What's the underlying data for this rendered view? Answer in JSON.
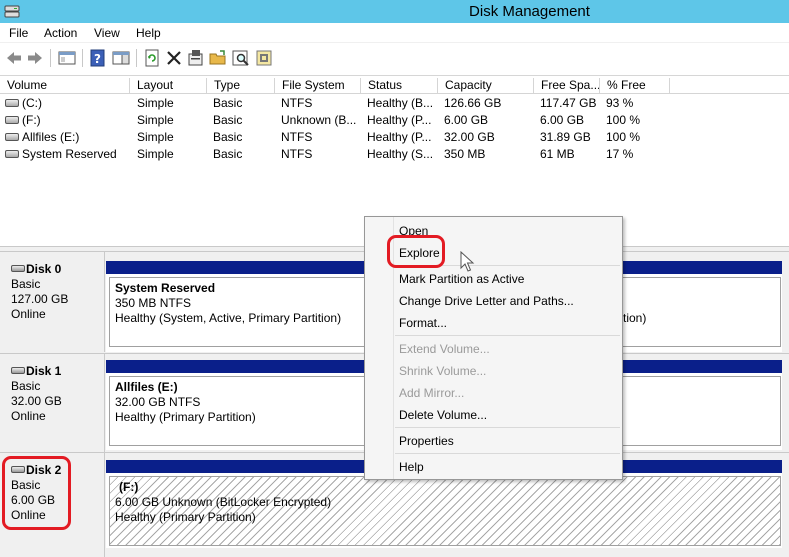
{
  "window": {
    "title": "Disk Management",
    "icon": "disk-management-icon"
  },
  "menu": [
    "File",
    "Action",
    "View",
    "Help"
  ],
  "toolbar": {
    "buttons": [
      "back-icon",
      "forward-icon",
      "console-icon",
      "help-icon",
      "properties-pane-icon",
      "refresh-icon",
      "delete-icon",
      "properties-icon",
      "open-icon",
      "search-icon",
      "settings-icon"
    ]
  },
  "volume_table": {
    "columns": [
      "Volume",
      "Layout",
      "Type",
      "File System",
      "Status",
      "Capacity",
      "Free Spa...",
      "% Free"
    ],
    "rows": [
      [
        "(C:)",
        "Simple",
        "Basic",
        "NTFS",
        "Healthy (B...",
        "126.66 GB",
        "117.47 GB",
        "93 %"
      ],
      [
        "(F:)",
        "Simple",
        "Basic",
        "Unknown (B...",
        "Healthy (P...",
        "6.00 GB",
        "6.00 GB",
        "100 %"
      ],
      [
        "Allfiles (E:)",
        "Simple",
        "Basic",
        "NTFS",
        "Healthy (P...",
        "32.00 GB",
        "31.89 GB",
        "100 %"
      ],
      [
        "System Reserved",
        "Simple",
        "Basic",
        "NTFS",
        "Healthy (S...",
        "350 MB",
        "61 MB",
        "17 %"
      ]
    ]
  },
  "disks": [
    {
      "name": "Disk 0",
      "type": "Basic",
      "size": "127.00 GB",
      "state": "Online",
      "partition": {
        "name": "System Reserved",
        "size_fs": "350 MB NTFS",
        "status": "Healthy (System, Active, Primary Partition)",
        "status_tail": "tion)"
      }
    },
    {
      "name": "Disk 1",
      "type": "Basic",
      "size": "32.00 GB",
      "state": "Online",
      "partition": {
        "name": "Allfiles  (E:)",
        "size_fs": "32.00 GB NTFS",
        "status": "Healthy (Primary Partition)"
      }
    },
    {
      "name": "Disk 2",
      "type": "Basic",
      "size": "6.00 GB",
      "state": "Online",
      "partition": {
        "name": "(F:)",
        "size_fs": "6.00 GB Unknown (BitLocker Encrypted)",
        "status": "Healthy (Primary Partition)"
      }
    }
  ],
  "context_menu": {
    "items": [
      {
        "label": "Open",
        "enabled": true
      },
      {
        "label": "Explore",
        "enabled": true
      },
      {
        "label": "Mark Partition as Active",
        "enabled": true
      },
      {
        "label": "Change Drive Letter and Paths...",
        "enabled": true
      },
      {
        "label": "Format...",
        "enabled": true
      },
      {
        "label": "Extend Volume...",
        "enabled": false
      },
      {
        "label": "Shrink Volume...",
        "enabled": false
      },
      {
        "label": "Add Mirror...",
        "enabled": false
      },
      {
        "label": "Delete Volume...",
        "enabled": true
      },
      {
        "label": "Properties",
        "enabled": true
      },
      {
        "label": "Help",
        "enabled": true
      }
    ]
  },
  "colors": {
    "titlebar": "#5ec6e8",
    "partition_bar": "#0a1f8a",
    "highlight": "#e31b23"
  }
}
